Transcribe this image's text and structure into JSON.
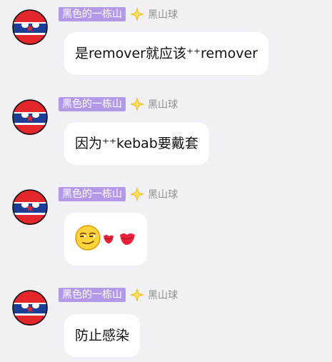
{
  "messages": [
    {
      "title_badge": "黑色的一栋山",
      "sender": "黑山球",
      "text": "是remover就应该⁺⁺remover",
      "avatar_icon": "montenegro-countryball-avatar",
      "level_icon": "sparkle-star-icon"
    },
    {
      "title_badge": "黑色的一栋山",
      "sender": "黑山球",
      "text": "因为⁺⁺kebab要戴套",
      "avatar_icon": "montenegro-countryball-avatar",
      "level_icon": "sparkle-star-icon"
    },
    {
      "title_badge": "黑色的一栋山",
      "sender": "黑山球",
      "emojis": [
        "smirk-face-emoji",
        "lips-emoji"
      ],
      "avatar_icon": "montenegro-countryball-avatar",
      "level_icon": "sparkle-star-icon"
    },
    {
      "title_badge": "黑色的一栋山",
      "sender": "黑山球",
      "text": "防止感染",
      "avatar_icon": "montenegro-countryball-avatar",
      "level_icon": "sparkle-star-icon"
    }
  ],
  "colors": {
    "background": "#f0f0f5",
    "badge": "#b39ae8",
    "bubble": "#ffffff",
    "sender_text": "#8e8e93"
  }
}
